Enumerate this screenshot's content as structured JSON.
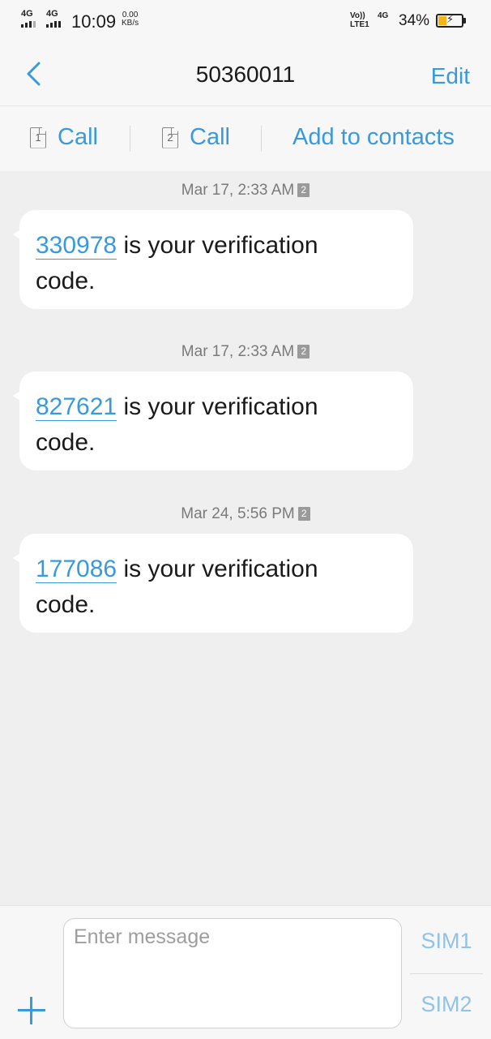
{
  "status_bar": {
    "net1": "4G",
    "net2": "4G",
    "time": "10:09",
    "speed_value": "0.00",
    "speed_unit": "KB/s",
    "volte": "Vo))",
    "lte": "LTE1",
    "net3": "4G",
    "battery_percent": "34%",
    "battery_level": 0.34,
    "battery_color": "#f3b51a"
  },
  "header": {
    "title": "50360011",
    "edit_label": "Edit"
  },
  "actions": {
    "call1_sim": "1",
    "call1_label": "Call",
    "call2_sim": "2",
    "call2_label": "Call",
    "add_contacts_label": "Add to contacts"
  },
  "messages": [
    {
      "timestamp": "Mar 17, 2:33 AM",
      "sim": "2",
      "code": "330978",
      "text_after": " is your verification",
      "text_line2": "code."
    },
    {
      "timestamp": "Mar 17, 2:33 AM",
      "sim": "2",
      "code": "827621",
      "text_after": " is your verification",
      "text_line2": "code."
    },
    {
      "timestamp": "Mar 24, 5:56 PM",
      "sim": "2",
      "code": "177086",
      "text_after": " is your verification",
      "text_line2": "code."
    }
  ],
  "composer": {
    "placeholder": "Enter message",
    "sim1_label": "SIM1",
    "sim2_label": "SIM2"
  },
  "colors": {
    "accent": "#3a9ad9",
    "background": "#efefef",
    "bubble": "#ffffff"
  }
}
